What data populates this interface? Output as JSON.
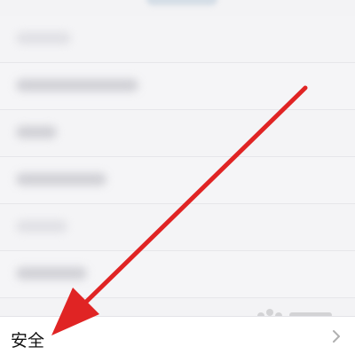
{
  "settings_list": {
    "rows": [
      {
        "blurred": true
      },
      {
        "blurred": true
      },
      {
        "blurred": true
      },
      {
        "blurred": true
      },
      {
        "blurred": true
      },
      {
        "blurred": true
      }
    ]
  },
  "bottom_item": {
    "label": "安全",
    "chevron_icon": "chevron-right-icon"
  },
  "annotation": {
    "arrow_color": "#e02424",
    "icon": "arrow-icon"
  },
  "colors": {
    "background": "#f3f3f5",
    "row_background": "#ffffff",
    "chevron": "#b0b0b0"
  }
}
